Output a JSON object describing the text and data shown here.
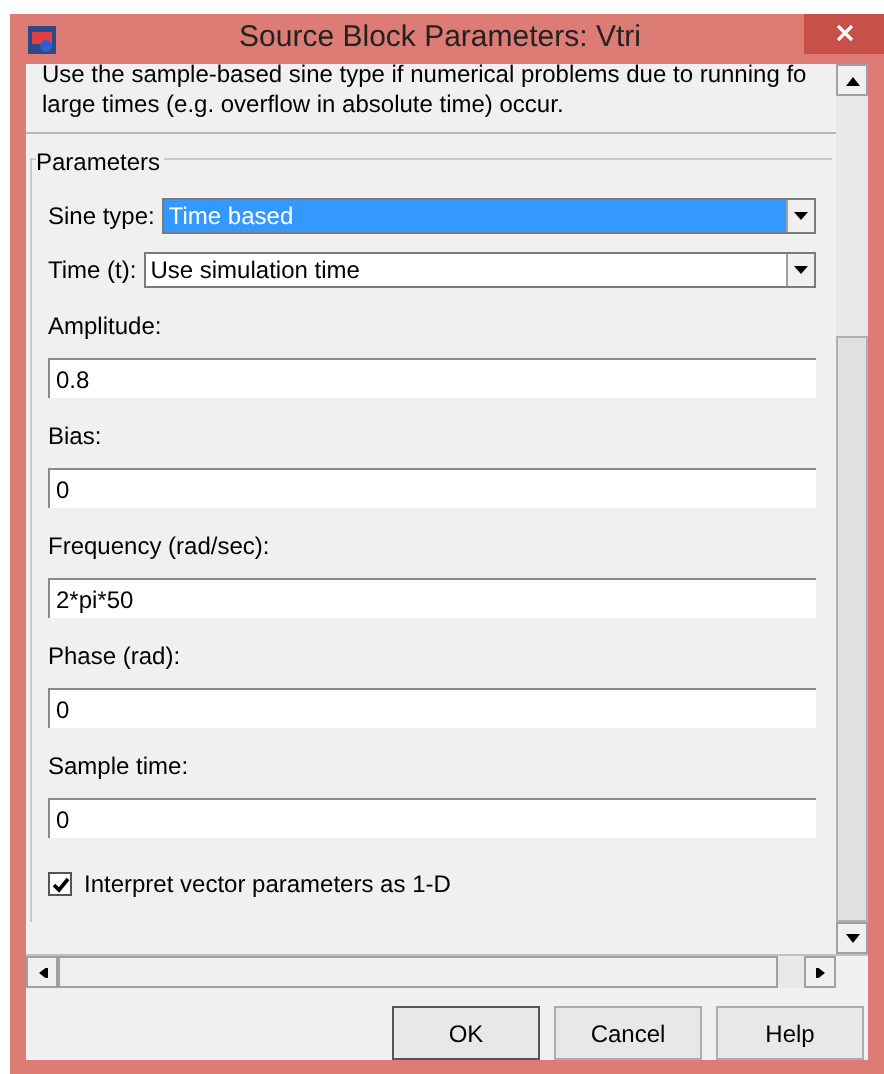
{
  "window": {
    "title": "Source Block Parameters: Vtri"
  },
  "description": [
    "Use the sample-based sine type if numerical problems due to running fo",
    "large times (e.g. overflow in absolute time) occur."
  ],
  "parameters": {
    "title": "Parameters",
    "fields": [
      {
        "kind": "dropdown",
        "label": "Sine type:",
        "value": "Time based",
        "selected": true
      },
      {
        "kind": "dropdown",
        "label": "Time (t):",
        "value": "Use simulation time",
        "selected": false
      },
      {
        "kind": "text",
        "label": "Amplitude:",
        "value": "0.8"
      },
      {
        "kind": "text",
        "label": "Bias:",
        "value": "0"
      },
      {
        "kind": "text",
        "label": "Frequency (rad/sec):",
        "value": "2*pi*50"
      },
      {
        "kind": "text",
        "label": "Phase (rad):",
        "value": "0"
      },
      {
        "kind": "text",
        "label": "Sample time:",
        "value": "0"
      }
    ],
    "checkbox": {
      "label": "Interpret vector parameters as 1-D",
      "checked": true
    }
  },
  "buttons": [
    "OK",
    "Cancel",
    "Help"
  ]
}
